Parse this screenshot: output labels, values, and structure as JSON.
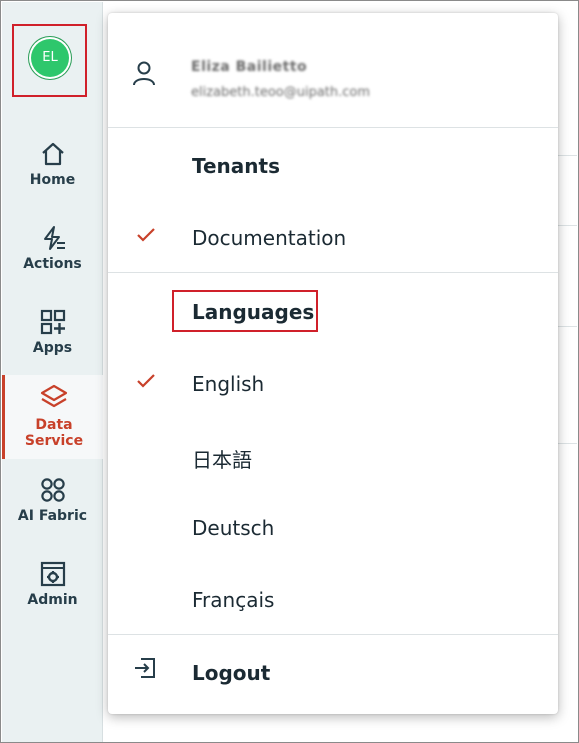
{
  "user": {
    "initials": "EL",
    "name": "Eliza Bailietto",
    "email": "elizabeth.teoo@uipath.com"
  },
  "nav": {
    "items": [
      {
        "label": "Home",
        "icon": "home-icon"
      },
      {
        "label": "Actions",
        "icon": "actions-icon"
      },
      {
        "label": "Apps",
        "icon": "apps-icon"
      },
      {
        "label_line1": "Data",
        "label_line2": "Service",
        "icon": "data-service-icon",
        "active": true
      },
      {
        "label": "AI Fabric",
        "icon": "ai-fabric-icon"
      },
      {
        "label": "Admin",
        "icon": "admin-icon"
      }
    ]
  },
  "menu": {
    "tenants_heading": "Tenants",
    "tenants": [
      {
        "label": "Documentation",
        "selected": true
      }
    ],
    "languages_heading": "Languages",
    "languages": [
      {
        "label": "English",
        "selected": true
      },
      {
        "label": "日本語",
        "selected": false
      },
      {
        "label": "Deutsch",
        "selected": false
      },
      {
        "label": "Français",
        "selected": false
      }
    ],
    "logout_label": "Logout"
  },
  "colors": {
    "accent": "#c8412a",
    "avatar": "#2ec76c",
    "highlight_box": "#d0202a",
    "rail_bg": "#eaf1f2"
  }
}
